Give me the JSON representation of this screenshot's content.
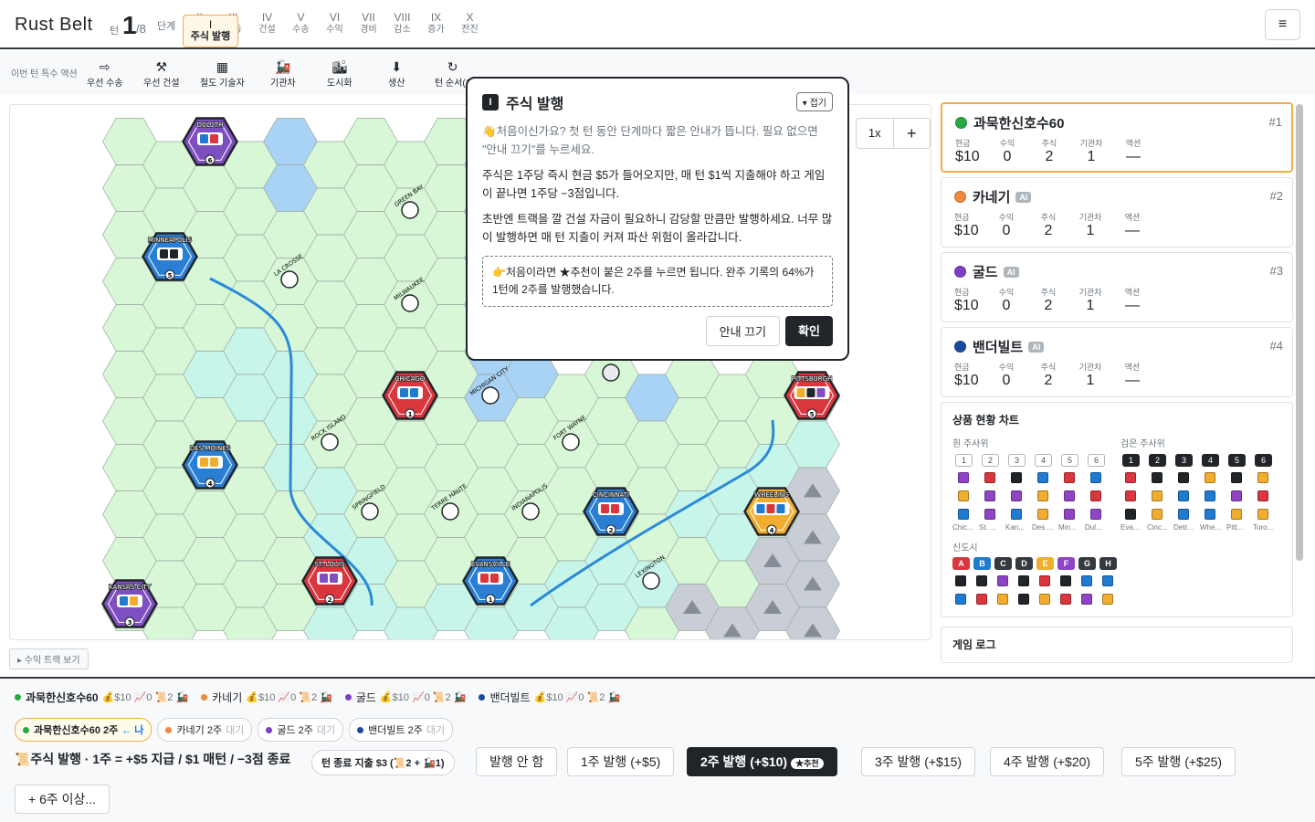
{
  "header": {
    "title": "Rust Belt",
    "turn_label": "턴",
    "turn": "1",
    "turn_total": "/8",
    "phase_label": "단계",
    "phases": [
      {
        "r": "I",
        "n": "주식 발행"
      },
      {
        "r": "II",
        "n": "경매"
      },
      {
        "r": "III",
        "n": "행동"
      },
      {
        "r": "IV",
        "n": "건설"
      },
      {
        "r": "V",
        "n": "수송"
      },
      {
        "r": "VI",
        "n": "수익"
      },
      {
        "r": "VII",
        "n": "경비"
      },
      {
        "r": "VIII",
        "n": "감소"
      },
      {
        "r": "IX",
        "n": "증가"
      },
      {
        "r": "X",
        "n": "전진"
      }
    ],
    "menu_icon": "≡"
  },
  "actions": {
    "label": "이번 턴 특수 액션",
    "items": [
      {
        "icon": "⇨",
        "label": "우선 수송"
      },
      {
        "icon": "⚒",
        "label": "우선 건설"
      },
      {
        "icon": "▦",
        "label": "철도 기술자"
      },
      {
        "icon": "🚂",
        "label": "기관차"
      },
      {
        "icon": "🏙",
        "label": "도시화"
      },
      {
        "icon": "⬇",
        "label": "생산"
      },
      {
        "icon": "↻",
        "label": "턴 순서(1"
      }
    ]
  },
  "map": {
    "zoom": "1x",
    "zoom_plus": "+",
    "cities": [
      {
        "name": "DULUTH",
        "num": "6",
        "color": "#7e4fc1",
        "cubes": [
          "#1f7bd1",
          "#d9363e"
        ]
      },
      {
        "name": "MINNEAPOLIS",
        "num": "5",
        "color": "#2a7fd4",
        "cubes": [
          "#212529",
          "#212529"
        ]
      },
      {
        "name": "CHICAGO",
        "num": "1",
        "color": "#d9363e",
        "cubes": [
          "#1f7bd1",
          "#1f7bd1"
        ]
      },
      {
        "name": "PITTSBURGH",
        "num": "5",
        "color": "#d9363e",
        "cubes": [
          "#f0ad2e",
          "#212529",
          "#7e4fc1"
        ]
      },
      {
        "name": "DES MOINES",
        "num": "4",
        "color": "#2a7fd4",
        "cubes": [
          "#f0ad2e",
          "#f0ad2e"
        ]
      },
      {
        "name": "CINCINNATI",
        "num": "2",
        "color": "#2a7fd4",
        "cubes": [
          "#d9363e",
          "#d9363e"
        ]
      },
      {
        "name": "WHEELING",
        "num": "4",
        "color": "#f0ad2e",
        "cubes": [
          "#1f7bd1",
          "#d9363e",
          "#1f7bd1"
        ]
      },
      {
        "name": "ST. LOUIS",
        "num": "2",
        "color": "#d9363e",
        "cubes": [
          "#7e4fc1",
          "#7e4fc1"
        ]
      },
      {
        "name": "EVANSVILLE",
        "num": "1",
        "color": "#2a7fd4",
        "cubes": [
          "#d9363e",
          "#d9363e"
        ]
      },
      {
        "name": "KANSAS CITY",
        "num": "3",
        "color": "#7e4fc1",
        "cubes": [
          "#1f7bd1",
          "#f0ad2e"
        ]
      }
    ],
    "towns": [
      "GREEN BAY",
      "LA CROSSE",
      "MILWAUKEE",
      "MICHIGAN CITY",
      "ROCK ISLAND",
      "FORT WAYNE",
      "SPRINGFIELD",
      "TERRE HAUTE",
      "INDIANAPOLIS",
      "LEXINGTON"
    ],
    "income_btn": "▸ 수익 트랙 보기"
  },
  "tip": {
    "badge": "I",
    "title": "주식 발행",
    "fold": "▾ 접기",
    "p1": "👋처음이신가요? 첫 턴 동안 단계마다 짧은 안내가 뜹니다. 필요 없으면 \"안내 끄기\"를 누르세요.",
    "p2": "주식은 1주당 즉시 현금 $5가 들어오지만, 매 턴 $1씩 지출해야 하고 게임이 끝나면 1주당 −3점입니다.",
    "p3": "초반엔 트랙을 깔 건설 자금이 필요하니 감당할 만큼만 발행하세요. 너무 많이 발행하면 매 턴 지출이 커져 파산 위험이 올라갑니다.",
    "box": "👉처음이라면 ★추천이 붙은 2주를 누르면 됩니다. 완주 기록의 64%가 1턴에 2주를 발행했습니다.",
    "btn_off": "안내 끄기",
    "btn_ok": "확인"
  },
  "players": [
    {
      "name": "과묵한신호수60",
      "rank": "#1",
      "color": "#28a745",
      "ai": "",
      "cash": "$10",
      "income": "0",
      "shares": "2",
      "loco": "1",
      "action": "—"
    },
    {
      "name": "카네기",
      "rank": "#2",
      "color": "#f0883e",
      "ai": "AI",
      "cash": "$10",
      "income": "0",
      "shares": "2",
      "loco": "1",
      "action": "—"
    },
    {
      "name": "굴드",
      "rank": "#3",
      "color": "#7e3fc4",
      "ai": "AI",
      "cash": "$10",
      "income": "0",
      "shares": "2",
      "loco": "1",
      "action": "—"
    },
    {
      "name": "밴더빌트",
      "rank": "#4",
      "color": "#1b4a9c",
      "ai": "AI",
      "cash": "$10",
      "income": "0",
      "shares": "2",
      "loco": "1",
      "action": "—"
    }
  ],
  "stat_labels": {
    "cash": "현금",
    "income": "수익",
    "shares": "주식",
    "loco": "기관차",
    "action": "액션"
  },
  "goods": {
    "title": "상품 현황 차트",
    "white_label": "흰 주사위",
    "black_label": "검은 주사위",
    "new_label": "신도시",
    "nums": [
      "1",
      "2",
      "3",
      "4",
      "5",
      "6"
    ],
    "white_cities": [
      "Chic...",
      "St. ...",
      "Kan...",
      "Des ...",
      "Min...",
      "Dul..."
    ],
    "black_cities": [
      "Eva...",
      "Cinc...",
      "Detr...",
      "Whe...",
      "Pitt...",
      "Toro..."
    ],
    "letters": [
      "A",
      "B",
      "C",
      "D",
      "E",
      "F",
      "G",
      "H"
    ],
    "log_title": "게임 로그"
  },
  "bottom": {
    "players": [
      {
        "name": "과묵한신호수60",
        "color": "#28a745"
      },
      {
        "name": "카네기",
        "color": "#f0883e"
      },
      {
        "name": "굴드",
        "color": "#7e3fc4"
      },
      {
        "name": "밴더빌트",
        "color": "#1b4a9c"
      }
    ],
    "stat": "💰$10 📈0 📜2 🚂",
    "pills": [
      {
        "name": "과묵한신호수60 2주",
        "tag": "← 나",
        "color": "#28a745"
      },
      {
        "name": "카네기 2주",
        "tag": "대기",
        "color": "#f0883e"
      },
      {
        "name": "굴드 2주",
        "tag": "대기",
        "color": "#7e3fc4"
      },
      {
        "name": "밴더빌트 2주",
        "tag": "대기",
        "color": "#1b4a9c"
      }
    ],
    "action_line": "📜주식 발행 · 1주 = +$5 지급 / $1 매턴 / −3점 종료",
    "upkeep": "턴 종료 지출 $3 (📜2 + 🚂1)",
    "options": [
      "발행 안 함",
      "1주 발행 (+$5)",
      "2주 발행 (+$10)",
      "3주 발행 (+$15)",
      "4주 발행 (+$20)",
      "5주 발행 (+$25)",
      "+ 6주 이상..."
    ],
    "recommend": "★추천"
  }
}
